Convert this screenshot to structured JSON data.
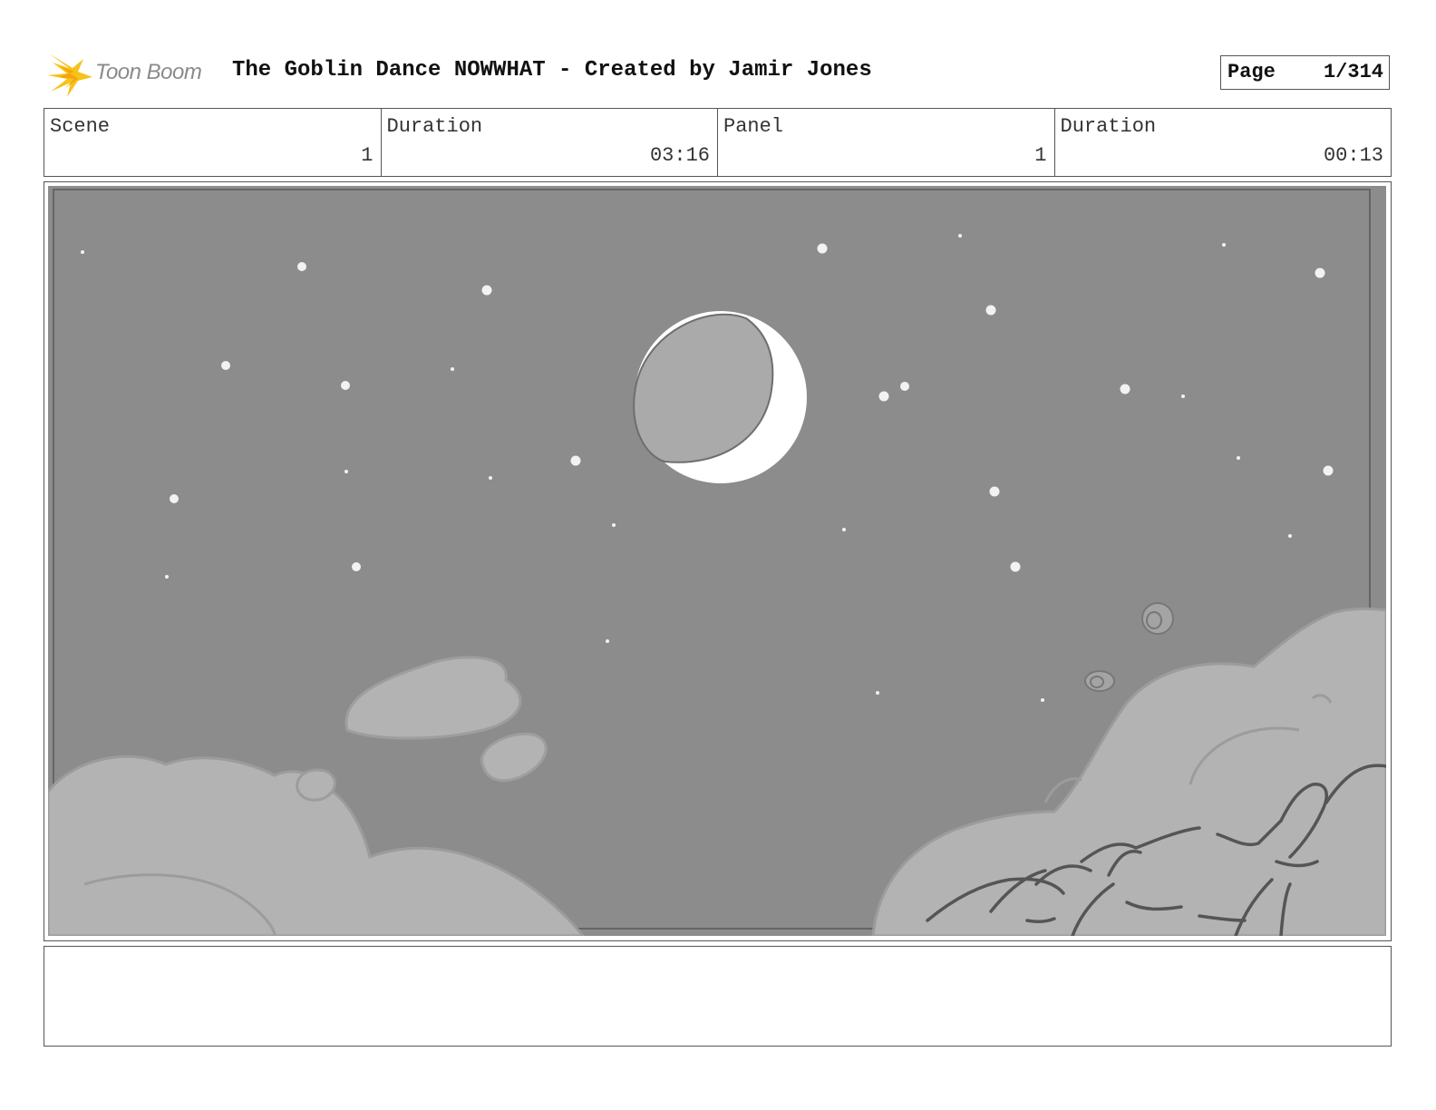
{
  "header": {
    "logo_text": "Toon Boom",
    "title": "The Goblin Dance NOWWHAT - Created by Jamir Jones",
    "page_label": "Page",
    "page_number": "1/314"
  },
  "info": {
    "scene_label": "Scene",
    "scene_value": "1",
    "scene_duration_label": "Duration",
    "scene_duration_value": "03:16",
    "panel_label": "Panel",
    "panel_value": "1",
    "panel_duration_label": "Duration",
    "panel_duration_value": "00:13"
  },
  "notes": {
    "text": ""
  },
  "colors": {
    "sky": "#8c8c8c",
    "moon_light": "#ffffff",
    "moon_shadow": "#aaaaaa",
    "clouds": "#b3b3b3",
    "sketch_lines": "#555555",
    "logo_burst": "#f5c31a"
  }
}
